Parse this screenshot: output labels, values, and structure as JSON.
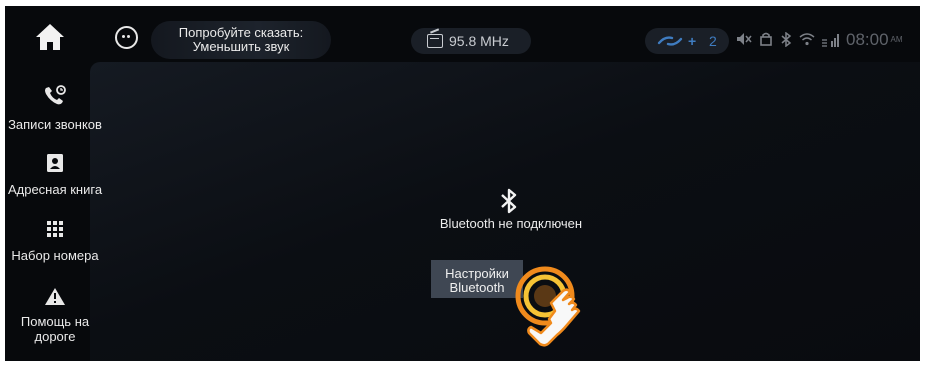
{
  "topbar": {
    "home_icon": "home-icon",
    "voice_icon": "voice-assistant-icon",
    "voice_hint_line1": "Попробуйте сказать:",
    "voice_hint_line2": "Уменьшить звук",
    "radio_icon": "radio-icon",
    "radio_frequency": "95.8 MHz",
    "phone_link_icon": "phone-link-icon",
    "phone_link_count": "2",
    "status_icons": [
      "mute-icon",
      "lock-icon",
      "bluetooth-icon",
      "wifi-icon",
      "signal-icon"
    ],
    "clock_time": "08:00",
    "clock_ampm": "AM"
  },
  "sidebar": {
    "items": [
      {
        "icon": "call-log-icon",
        "label": "Записи звонков"
      },
      {
        "icon": "contacts-icon",
        "label": "Адресная книга"
      },
      {
        "icon": "dialpad-icon",
        "label": "Набор номера"
      },
      {
        "icon": "roadside-assistance-icon",
        "label_line1": "Помощь на",
        "label_line2": "дороге"
      }
    ]
  },
  "main": {
    "bluetooth_icon": "bluetooth-icon",
    "status_text": "Bluetooth не подключен",
    "settings_button_line1": "Настройки",
    "settings_button_line2": "Bluetooth",
    "touch_indicator_icon": "tap-hand-icon"
  },
  "colors": {
    "background": "#07090c",
    "accent_blue": "#3f7cc0",
    "button_gray": "#3f4753",
    "touch_orange": "#f08a1c",
    "touch_yellow": "#f6c335",
    "text_light": "#eaeaea"
  }
}
